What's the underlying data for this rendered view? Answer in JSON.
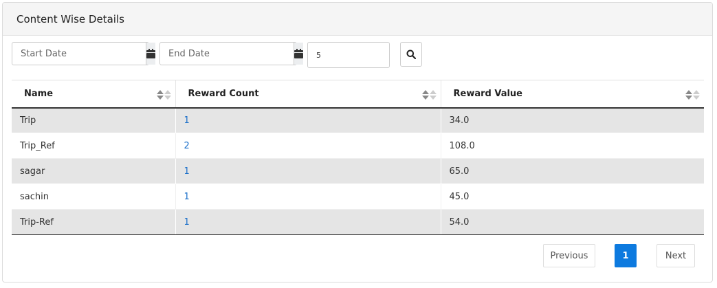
{
  "card": {
    "title": "Content Wise Details"
  },
  "filters": {
    "start_date_placeholder": "Start Date",
    "end_date_placeholder": "End Date",
    "count_value": "5",
    "calendar_icon": "calendar-icon",
    "search_icon": "search-icon"
  },
  "table": {
    "columns": [
      "Name",
      "Reward Count",
      "Reward Value"
    ],
    "rows": [
      {
        "name": "Trip",
        "reward_count": "1",
        "reward_value": "34.0"
      },
      {
        "name": "Trip_Ref",
        "reward_count": "2",
        "reward_value": "108.0"
      },
      {
        "name": "sagar",
        "reward_count": "1",
        "reward_value": "65.0"
      },
      {
        "name": "sachin",
        "reward_count": "1",
        "reward_value": "45.0"
      },
      {
        "name": "Trip-Ref",
        "reward_count": "1",
        "reward_value": "54.0"
      }
    ]
  },
  "pagination": {
    "previous": "Previous",
    "current_page": "1",
    "next": "Next"
  },
  "colors": {
    "link": "#1a6fc9",
    "active_page": "#0d7adf",
    "stripe": "#e5e5e5"
  }
}
